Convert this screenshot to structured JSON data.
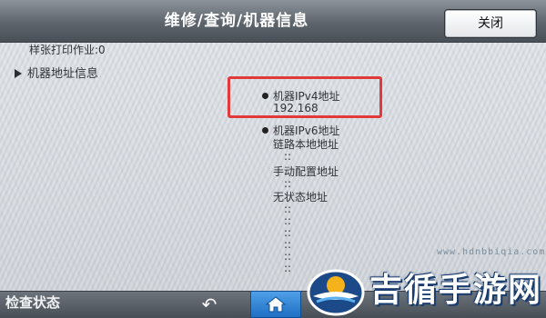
{
  "header": {
    "title": "维修/查询/机器信息",
    "close_label": "关闭"
  },
  "content": {
    "sample_jobs": "样张打印作业:0",
    "machine_address_section": "机器地址信息",
    "ipv4_label": "机器IPv4地址",
    "ipv4_value": "192.168",
    "ipv6_label": "机器IPv6地址",
    "link_local_label": "链路本地地址",
    "colon_sep": "::",
    "manual_config_label": "手动配置地址",
    "stateless_label": "无状态地址"
  },
  "footer": {
    "status_label": "检查状态",
    "back_icon": "back-arrow-icon",
    "home_icon": "home-icon"
  },
  "watermark": {
    "brand_text": "吉循手游网",
    "url_text": "www.hdnbbiqia.com"
  },
  "colors": {
    "highlight": "#e23a3a",
    "home_button": "#2a7fd4"
  }
}
